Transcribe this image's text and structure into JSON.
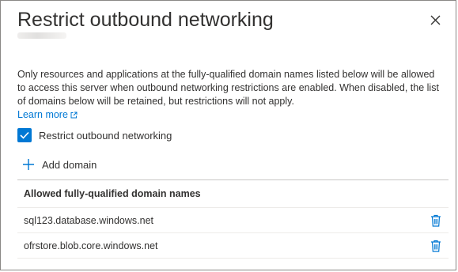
{
  "panel": {
    "title": "Restrict outbound networking",
    "close_icon": "close-icon"
  },
  "description": "Only resources and applications at the fully-qualified domain names listed below will be allowed to access this server when outbound networking restrictions are enabled. When disabled, the list of domains below will be retained, but restrictions will not apply.",
  "learn_more": {
    "label": "Learn more",
    "icon": "external-link-icon"
  },
  "restrict_checkbox": {
    "label": "Restrict outbound networking",
    "checked": true
  },
  "add_domain": {
    "label": "Add domain",
    "icon": "plus-icon"
  },
  "table": {
    "header": "Allowed fully-qualified domain names",
    "rows": [
      {
        "domain": "sql123.database.windows.net",
        "action_icon": "trash-icon"
      },
      {
        "domain": "ofrstore.blob.core.windows.net",
        "action_icon": "trash-icon"
      }
    ]
  },
  "colors": {
    "accent": "#0078d4",
    "text": "#323130",
    "border": "#8a8886"
  }
}
